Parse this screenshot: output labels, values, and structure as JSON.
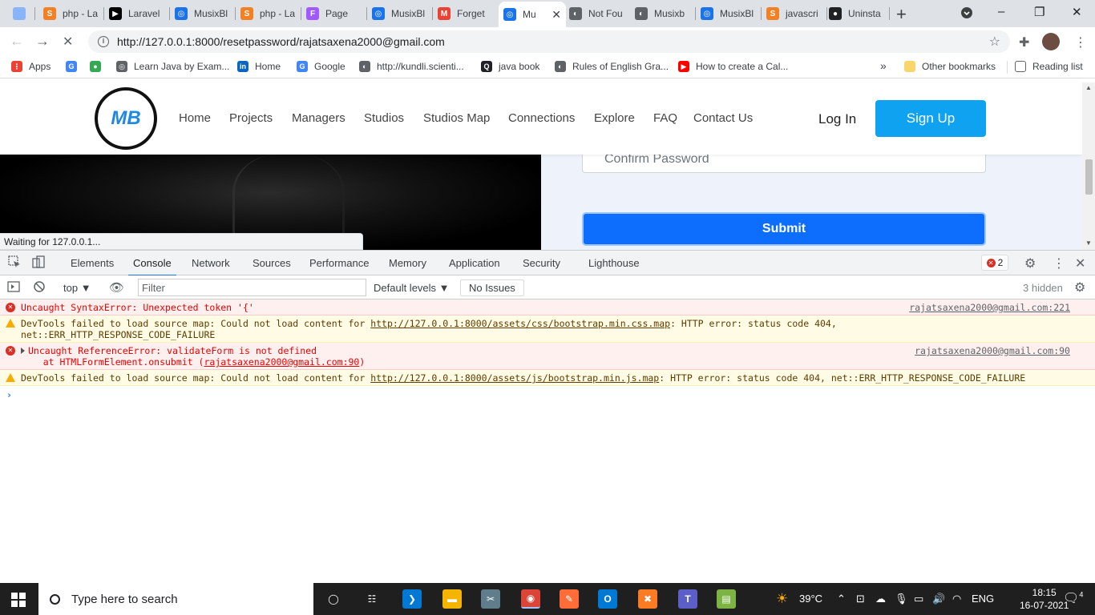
{
  "tabs": [
    {
      "label": "",
      "color": "#8ab4f8",
      "glyph": ""
    },
    {
      "label": "php - La",
      "color": "#f48024",
      "glyph": "S"
    },
    {
      "label": "Laravel",
      "color": "#000000",
      "glyph": "▶"
    },
    {
      "label": "MusixBl",
      "color": "#1a73e8",
      "glyph": "◎"
    },
    {
      "label": "php - La",
      "color": "#f48024",
      "glyph": "S"
    },
    {
      "label": "Page",
      "color": "#a259ff",
      "glyph": "F"
    },
    {
      "label": "MusixBl",
      "color": "#1a73e8",
      "glyph": "◎"
    },
    {
      "label": "Forget",
      "color": "#ea4335",
      "glyph": "M"
    },
    {
      "label": "Mu",
      "color": "#1a73e8",
      "glyph": "◎"
    },
    {
      "label": "Not Fou",
      "color": "#5f6368",
      "glyph": "◐"
    },
    {
      "label": "Musixb",
      "color": "#5f6368",
      "glyph": "◐"
    },
    {
      "label": "MusixBl",
      "color": "#1a73e8",
      "glyph": "◎"
    },
    {
      "label": "javascri",
      "color": "#f48024",
      "glyph": "S"
    },
    {
      "label": "Uninsta",
      "color": "#202124",
      "glyph": "●"
    }
  ],
  "window_controls": {
    "minimize": "–",
    "maximize": "❐",
    "close": "✕"
  },
  "address_bar": {
    "url": "http://127.0.0.1:8000/resetpassword/rajatsaxena2000@gmail.com"
  },
  "bookmarks": [
    {
      "label": "Apps",
      "color": "#ea4335",
      "glyph": "⋮"
    },
    {
      "label": "",
      "color": "#4285f4",
      "glyph": "G"
    },
    {
      "label": "",
      "color": "#34a853",
      "glyph": "●"
    },
    {
      "label": "Learn Java by Exam...",
      "color": "#5f6368",
      "glyph": "◎"
    },
    {
      "label": "Home",
      "color": "#0a66c2",
      "glyph": "in"
    },
    {
      "label": "Google",
      "color": "#4285f4",
      "glyph": "G"
    },
    {
      "label": "http://kundli.scienti...",
      "color": "#5f6368",
      "glyph": "◐"
    },
    {
      "label": "java book",
      "color": "#202124",
      "glyph": "Q"
    },
    {
      "label": "Rules of English Gra...",
      "color": "#5f6368",
      "glyph": "◐"
    },
    {
      "label": "How to create a Cal...",
      "color": "#ff0000",
      "glyph": "▶"
    }
  ],
  "bookmarks_right": {
    "more": "»",
    "other": "Other bookmarks",
    "reading": "Reading list"
  },
  "site": {
    "nav": [
      "Home",
      "Projects",
      "Managers",
      "Studios",
      "Studios Map",
      "Connections",
      "Explore",
      "FAQ",
      "Contact Us"
    ],
    "logo_text": "MB",
    "login": "Log In",
    "signup": "Sign Up",
    "confirm_placeholder": "Confirm Password",
    "submit": "Submit"
  },
  "status_bubble": "Waiting for 127.0.0.1...",
  "devtools": {
    "tabs": [
      "Elements",
      "Console",
      "Network",
      "Sources",
      "Performance",
      "Memory",
      "Application",
      "Security",
      "Lighthouse"
    ],
    "active_tab": "Console",
    "error_count": "2",
    "context": "top",
    "filter_placeholder": "Filter",
    "levels": "Default levels",
    "issues": "No Issues",
    "hidden": "3 hidden",
    "messages": [
      {
        "level": "error",
        "text": "Uncaught SyntaxError: Unexpected token '{'",
        "source": "rajatsaxena2000@gmail.com:221"
      },
      {
        "level": "warn",
        "prefix": "DevTools failed to load source map: Could not load content for ",
        "link": "http://127.0.0.1:8000/assets/css/bootstrap.min.css.map",
        "suffix": ": HTTP error: status code 404,",
        "line2": "net::ERR_HTTP_RESPONSE_CODE_FAILURE"
      },
      {
        "level": "error",
        "text": "Uncaught ReferenceError: validateForm is not defined",
        "line2_prefix": "    at HTMLFormElement.onsubmit (",
        "line2_link": "rajatsaxena2000@gmail.com:90",
        "line2_suffix": ")",
        "source": "rajatsaxena2000@gmail.com:90"
      },
      {
        "level": "warn",
        "prefix": "DevTools failed to load source map: Could not load content for ",
        "link": "http://127.0.0.1:8000/assets/js/bootstrap.min.js.map",
        "suffix": ": HTTP error: status code 404, net::ERR_HTTP_RESPONSE_CODE_FAILURE"
      }
    ]
  },
  "taskbar": {
    "search_placeholder": "Type here to search",
    "weather": "39°C",
    "lang": "ENG",
    "time": "18:15",
    "date": "16-07-2021",
    "notifications": "4",
    "apps": [
      {
        "name": "task-view",
        "color": "#1f1f1f",
        "glyph": "◯"
      },
      {
        "name": "widgets",
        "color": "#1f1f1f",
        "glyph": "☷"
      },
      {
        "name": "vscode",
        "color": "#0078d4",
        "glyph": "❯"
      },
      {
        "name": "file-explorer",
        "color": "#f4b400",
        "glyph": "▬"
      },
      {
        "name": "snipping",
        "color": "#607d8b",
        "glyph": "✂"
      },
      {
        "name": "chrome",
        "color": "#db4437",
        "glyph": "◉"
      },
      {
        "name": "postman",
        "color": "#ff6c37",
        "glyph": "✎"
      },
      {
        "name": "outlook",
        "color": "#0078d4",
        "glyph": "O"
      },
      {
        "name": "xampp",
        "color": "#fb7a24",
        "glyph": "✖"
      },
      {
        "name": "teams",
        "color": "#5b5fc7",
        "glyph": "T"
      },
      {
        "name": "sticky",
        "color": "#7cb342",
        "glyph": "▤"
      }
    ]
  }
}
